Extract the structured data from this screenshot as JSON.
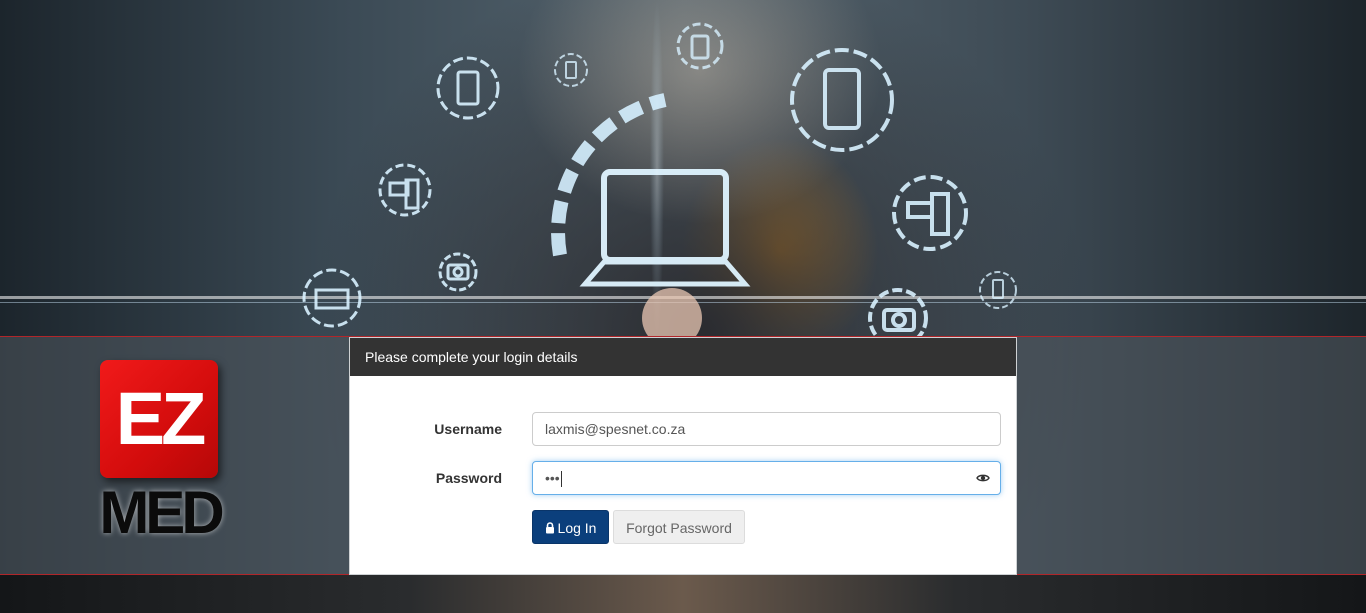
{
  "logo": {
    "top_text": "EZ",
    "bottom_text": "MED",
    "color": "#e01010"
  },
  "panel": {
    "header": "Please complete your login details"
  },
  "form": {
    "username_label": "Username",
    "username_value": "laxmis@spesnet.co.za",
    "password_label": "Password",
    "password_value": "•••",
    "login_label": "Log In",
    "forgot_label": "Forgot Password"
  },
  "icons": {
    "login": "lock-icon",
    "password_toggle": "eye-icon"
  },
  "colors": {
    "accent_red": "#b1262a",
    "login_button": "#0b3f7c",
    "header_bg": "#333333",
    "focus_border": "#66afe9"
  }
}
